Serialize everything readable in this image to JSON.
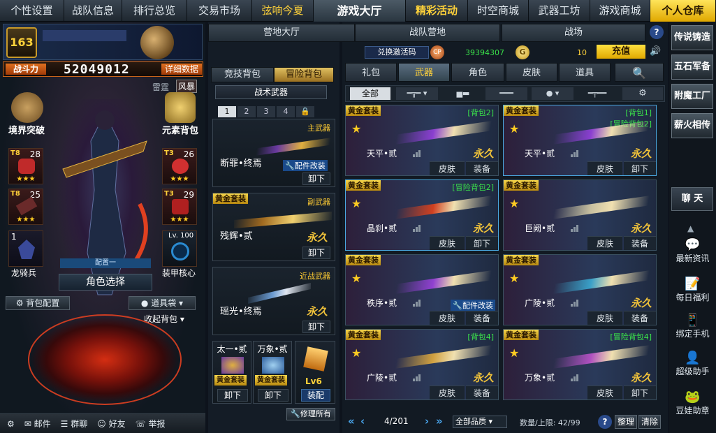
{
  "topnav": {
    "items": [
      {
        "label": "个性设置",
        "w": 92
      },
      {
        "label": "战队信息",
        "w": 83
      },
      {
        "label": "排行总览",
        "w": 93
      },
      {
        "label": "交易市场",
        "w": 93
      },
      {
        "label": "弦响今夏",
        "w": 88
      },
      {
        "label": "游戏大厅",
        "w": 132
      },
      {
        "label": "精彩活动",
        "w": 89
      },
      {
        "label": "时空商城",
        "w": 87
      },
      {
        "label": "武器工坊",
        "w": 88
      },
      {
        "label": "游戏商城",
        "w": 86
      },
      {
        "label": "个人仓库",
        "w": 94
      }
    ]
  },
  "player": {
    "level_badge": "163",
    "power_label": "战斗力",
    "power_value": "52049012",
    "detail_button": "详细数据",
    "mode_a": "雷霆",
    "mode_b": "风暴",
    "left_action": "境界突破",
    "right_action": "元素背包",
    "slots": [
      {
        "tier": "T8",
        "lv": "28",
        "stars": "★★★"
      },
      {
        "tier": "T3",
        "lv": "26",
        "stars": "★★★"
      },
      {
        "tier": "T8",
        "lv": "25",
        "stars": "★★★"
      },
      {
        "tier": "T3",
        "lv": "29",
        "stars": "★★★"
      },
      {
        "tier": "",
        "lv": "1",
        "stars": ""
      }
    ],
    "core_lv": "Lv. 100",
    "core_label": "装甲核心",
    "left_char_label": "龙骑兵",
    "config_label": "配置一",
    "role_select": "角色选择",
    "pack_config": "背包配置",
    "tool_bag": "道具袋",
    "collapse_bag": "收起背包"
  },
  "bottombar": {
    "mail": "邮件",
    "group_chat": "群聊",
    "friends": "好友",
    "report": "举报"
  },
  "middle": {
    "tab_competitive": "竞技背包",
    "tab_adventure": "冒险背包",
    "tactical": "战术武器",
    "pages": [
      "1",
      "2",
      "3",
      "4"
    ],
    "primary": {
      "slot": "主武器",
      "name": "断罪•终焉",
      "mod": "配件改装",
      "unload": "卸下"
    },
    "secondary": {
      "slot": "副武器",
      "name": "残辉•贰",
      "tag": "黄金套装",
      "forever": "永久",
      "unload": "卸下"
    },
    "melee": {
      "slot": "近战武器",
      "name": "瑶光•终焉",
      "forever": "永久",
      "unload": "卸下"
    },
    "throw1": {
      "name": "太一•贰",
      "tag": "黄金套装",
      "unload": "卸下"
    },
    "throw2": {
      "name": "万象•贰",
      "tag": "黄金套装",
      "unload": "卸下"
    },
    "level_item": {
      "lv": "Lv6",
      "btn": "装配"
    },
    "repair_all": "修理所有"
  },
  "right": {
    "subtabs": [
      "营地大厅",
      "战队营地",
      "战场"
    ],
    "redeem": "兑换激活码",
    "cp_value": "39394307",
    "coin_value": "10",
    "recharge": "充值",
    "cat_tabs": [
      "礼包",
      "武器",
      "角色",
      "皮肤",
      "道具"
    ],
    "filter_all": "全部",
    "cards": [
      {
        "tag": "黄金套装",
        "pack": "[背包2]",
        "name": "天平•贰",
        "forever": "永久",
        "a1": "皮肤",
        "a2": "装备",
        "color": "#8a3fd0"
      },
      {
        "tag": "黄金套装",
        "pack": "[背包1]",
        "pack2": "[冒险背包2]",
        "name": "天平•贰",
        "forever": "永久",
        "a1": "皮肤",
        "a2": "卸下",
        "color": "#8a3fd0"
      },
      {
        "tag": "黄金套装",
        "pack": "[冒险背包2]",
        "name": "晶刹•贰",
        "forever": "永久",
        "a1": "皮肤",
        "a2": "卸下",
        "color": "#d04020"
      },
      {
        "tag": "黄金套装",
        "pack": "",
        "name": "巨阙•贰",
        "forever": "永久",
        "a1": "皮肤",
        "a2": "装备",
        "color": "#c8c0a0"
      },
      {
        "tag": "黄金套装",
        "pack": "",
        "name": "秩序•贰",
        "forever": "",
        "mod": "配件改装",
        "a1": "皮肤",
        "a2": "装备",
        "color": "#9040d0"
      },
      {
        "tag": "黄金套装",
        "pack": "",
        "name": "广陵•贰",
        "forever": "永久",
        "a1": "皮肤",
        "a2": "装备",
        "color": "#3aa0c8"
      },
      {
        "tag": "黄金套装",
        "pack": "[背包4]",
        "name": "广陵•贰",
        "forever": "永久",
        "a1": "皮肤",
        "a2": "装备",
        "color": "#d0a040"
      },
      {
        "tag": "黄金套装",
        "pack": "[冒险背包4]",
        "name": "万象•贰",
        "forever": "永久",
        "a1": "皮肤",
        "a2": "卸下",
        "color": "#b050c0"
      }
    ],
    "pagination": "4/201",
    "quality": "全部品质",
    "capacity": "数量/上限: 42/99",
    "sort": "整理",
    "clear": "清除"
  },
  "farright": {
    "big": [
      "传说铸造",
      "五石军备",
      "附魔工厂",
      "薪火相传"
    ],
    "chat": "聊 天",
    "items": [
      "最新资讯",
      "每日福利",
      "绑定手机",
      "超级助手",
      "豆娃助章"
    ]
  }
}
